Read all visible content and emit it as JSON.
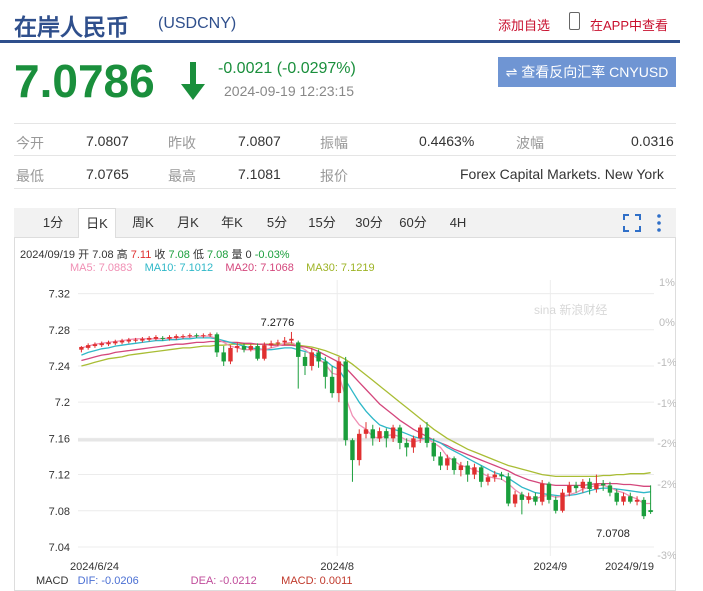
{
  "header": {
    "title": "在岸人民币",
    "code": "(USDCNY)",
    "add_fav": "添加自选",
    "app_view": "在APP中查看"
  },
  "quote": {
    "price": "7.0786",
    "change": "-0.0021 (-0.0297%)",
    "time": "2024-09-19 12:23:15",
    "reverse_btn": "⇌ 查看反向汇率 CNYUSD",
    "rows": [
      [
        {
          "label": "今开",
          "value": "7.0807"
        },
        {
          "label": "昨收",
          "value": "7.0807"
        },
        {
          "label": "振幅",
          "value": "0.4463%"
        },
        {
          "label": "波幅",
          "value": "0.0316"
        }
      ],
      [
        {
          "label": "最低",
          "value": "7.0765"
        },
        {
          "label": "最高",
          "value": "7.1081"
        },
        {
          "label": "报价",
          "value": "Forex Capital Markets. New York"
        }
      ]
    ]
  },
  "tabs": [
    "1分",
    "日K",
    "周K",
    "月K",
    "年K",
    "5分",
    "15分",
    "30分",
    "60分",
    "4H"
  ],
  "active_tab": 1,
  "chart_info": {
    "ohlc": {
      "date": "2024/09/19",
      "open_label": "开",
      "open": "7.08",
      "high_label": "高",
      "high": "7.11",
      "close_label": "收",
      "close": "7.08",
      "low_label": "低",
      "low": "7.08",
      "vol_label": "量",
      "vol": "0",
      "pct": "-0.03%"
    },
    "ma": [
      {
        "label": "MA5: 7.0883",
        "color": "#f08fb4"
      },
      {
        "label": "MA10: 7.1012",
        "color": "#2fb8c8"
      },
      {
        "label": "MA20: 7.1068",
        "color": "#d4477c"
      },
      {
        "label": "MA30: 7.1219",
        "color": "#9db325"
      }
    ],
    "macd_title": "MACD",
    "macd": [
      {
        "label": "DIF: -0.0206",
        "color": "#4a6fd3"
      },
      {
        "label": "DEA: -0.0212",
        "color": "#c04b9a"
      },
      {
        "label": "MACD: 0.0011",
        "color": "#c0392b"
      }
    ]
  },
  "chart_data": {
    "type": "candlestick",
    "y_ticks": [
      "7.32",
      "7.28",
      "7.24",
      "7.2",
      "7.16",
      "7.12",
      "7.08",
      "7.04"
    ],
    "ylim": [
      7.03,
      7.335
    ],
    "pct_ticks": [
      "1%",
      "0%",
      "-1%",
      "-1%",
      "-2%",
      "-2%",
      "-3%"
    ],
    "x_labels": [
      "2024/6/24",
      "2024/8",
      "2024/9",
      "2024/9/19"
    ],
    "annotations": [
      {
        "text": "7.2776"
      },
      {
        "text": "7.0708"
      }
    ],
    "watermark": "sina 新浪财经",
    "up_color": "#e03030",
    "down_color": "#1a9e3c",
    "candles": [
      [
        7.258,
        7.261,
        7.255,
        7.262
      ],
      [
        7.26,
        7.263,
        7.258,
        7.265
      ],
      [
        7.262,
        7.264,
        7.26,
        7.266
      ],
      [
        7.263,
        7.265,
        7.261,
        7.267
      ],
      [
        7.264,
        7.266,
        7.262,
        7.268
      ],
      [
        7.265,
        7.267,
        7.263,
        7.269
      ],
      [
        7.266,
        7.268,
        7.264,
        7.27
      ],
      [
        7.267,
        7.269,
        7.265,
        7.271
      ],
      [
        7.268,
        7.269,
        7.266,
        7.271
      ],
      [
        7.268,
        7.27,
        7.266,
        7.272
      ],
      [
        7.269,
        7.271,
        7.267,
        7.273
      ],
      [
        7.27,
        7.272,
        7.268,
        7.274
      ],
      [
        7.271,
        7.27,
        7.268,
        7.273
      ],
      [
        7.27,
        7.272,
        7.268,
        7.274
      ],
      [
        7.271,
        7.273,
        7.269,
        7.275
      ],
      [
        7.272,
        7.273,
        7.27,
        7.275
      ],
      [
        7.273,
        7.274,
        7.271,
        7.276
      ],
      [
        7.274,
        7.273,
        7.271,
        7.276
      ],
      [
        7.273,
        7.274,
        7.271,
        7.276
      ],
      [
        7.274,
        7.275,
        7.272,
        7.277
      ],
      [
        7.275,
        7.255,
        7.25,
        7.277
      ],
      [
        7.255,
        7.245,
        7.24,
        7.262
      ],
      [
        7.245,
        7.26,
        7.242,
        7.263
      ],
      [
        7.26,
        7.262,
        7.255,
        7.266
      ],
      [
        7.262,
        7.258,
        7.255,
        7.265
      ],
      [
        7.258,
        7.262,
        7.256,
        7.264
      ],
      [
        7.262,
        7.248,
        7.246,
        7.265
      ],
      [
        7.248,
        7.263,
        7.246,
        7.266
      ],
      [
        7.263,
        7.265,
        7.26,
        7.268
      ],
      [
        7.265,
        7.266,
        7.262,
        7.269
      ],
      [
        7.266,
        7.268,
        7.263,
        7.272
      ],
      [
        7.268,
        7.27,
        7.265,
        7.2776
      ],
      [
        7.266,
        7.25,
        7.215,
        7.268
      ],
      [
        7.25,
        7.24,
        7.23,
        7.255
      ],
      [
        7.24,
        7.255,
        7.235,
        7.26
      ],
      [
        7.255,
        7.245,
        7.238,
        7.258
      ],
      [
        7.245,
        7.228,
        7.215,
        7.25
      ],
      [
        7.228,
        7.21,
        7.205,
        7.24
      ],
      [
        7.21,
        7.245,
        7.2,
        7.25
      ],
      [
        7.245,
        7.158,
        7.152,
        7.25
      ],
      [
        7.158,
        7.136,
        7.112,
        7.16
      ],
      [
        7.136,
        7.165,
        7.13,
        7.17
      ],
      [
        7.165,
        7.17,
        7.16,
        7.178
      ],
      [
        7.17,
        7.16,
        7.152,
        7.175
      ],
      [
        7.16,
        7.168,
        7.156,
        7.172
      ],
      [
        7.168,
        7.16,
        7.15,
        7.171
      ],
      [
        7.16,
        7.172,
        7.156,
        7.175
      ],
      [
        7.172,
        7.155,
        7.148,
        7.175
      ],
      [
        7.155,
        7.15,
        7.14,
        7.16
      ],
      [
        7.15,
        7.16,
        7.144,
        7.163
      ],
      [
        7.16,
        7.172,
        7.155,
        7.175
      ],
      [
        7.172,
        7.155,
        7.15,
        7.178
      ],
      [
        7.155,
        7.14,
        7.135,
        7.16
      ],
      [
        7.14,
        7.13,
        7.125,
        7.145
      ],
      [
        7.13,
        7.138,
        7.125,
        7.142
      ],
      [
        7.138,
        7.125,
        7.12,
        7.14
      ],
      [
        7.125,
        7.13,
        7.118,
        7.134
      ],
      [
        7.13,
        7.12,
        7.112,
        7.135
      ],
      [
        7.12,
        7.128,
        7.115,
        7.132
      ],
      [
        7.128,
        7.112,
        7.106,
        7.13
      ],
      [
        7.112,
        7.117,
        7.108,
        7.121
      ],
      [
        7.117,
        7.12,
        7.112,
        7.124
      ],
      [
        7.12,
        7.118,
        7.114,
        7.123
      ],
      [
        7.118,
        7.088,
        7.085,
        7.122
      ],
      [
        7.088,
        7.098,
        7.084,
        7.102
      ],
      [
        7.098,
        7.092,
        7.076,
        7.101
      ],
      [
        7.092,
        7.096,
        7.088,
        7.1
      ],
      [
        7.096,
        7.09,
        7.086,
        7.1
      ],
      [
        7.09,
        7.11,
        7.086,
        7.114
      ],
      [
        7.11,
        7.092,
        7.088,
        7.112
      ],
      [
        7.092,
        7.08,
        7.077,
        7.096
      ],
      [
        7.08,
        7.1,
        7.078,
        7.104
      ],
      [
        7.1,
        7.108,
        7.096,
        7.112
      ],
      [
        7.108,
        7.105,
        7.1,
        7.112
      ],
      [
        7.105,
        7.112,
        7.1,
        7.115
      ],
      [
        7.112,
        7.104,
        7.098,
        7.116
      ],
      [
        7.104,
        7.11,
        7.1,
        7.12
      ],
      [
        7.11,
        7.108,
        7.102,
        7.114
      ],
      [
        7.108,
        7.1,
        7.096,
        7.112
      ],
      [
        7.1,
        7.09,
        7.086,
        7.104
      ],
      [
        7.09,
        7.096,
        7.086,
        7.1
      ],
      [
        7.096,
        7.09,
        7.088,
        7.1
      ],
      [
        7.09,
        7.092,
        7.086,
        7.096
      ],
      [
        7.092,
        7.074,
        7.0708,
        7.095
      ],
      [
        7.0807,
        7.0786,
        7.0765,
        7.1081
      ]
    ],
    "ma5": [
      7.26,
      7.262,
      7.264,
      7.265,
      7.266,
      7.267,
      7.268,
      7.269,
      7.27,
      7.27,
      7.27,
      7.27,
      7.27,
      7.271,
      7.271,
      7.272,
      7.272,
      7.273,
      7.273,
      7.273,
      7.27,
      7.266,
      7.262,
      7.26,
      7.258,
      7.258,
      7.258,
      7.258,
      7.26,
      7.262,
      7.265,
      7.266,
      7.262,
      7.258,
      7.252,
      7.248,
      7.242,
      7.232,
      7.23,
      7.205,
      7.185,
      7.175,
      7.17,
      7.162,
      7.16,
      7.163,
      7.164,
      7.162,
      7.158,
      7.156,
      7.158,
      7.16,
      7.155,
      7.15,
      7.14,
      7.135,
      7.13,
      7.128,
      7.125,
      7.122,
      7.118,
      7.116,
      7.115,
      7.11,
      7.103,
      7.098,
      7.094,
      7.093,
      7.096,
      7.097,
      7.095,
      7.096,
      7.098,
      7.1,
      7.104,
      7.106,
      7.108,
      7.108,
      7.106,
      7.102,
      7.1,
      7.096,
      7.093,
      7.088,
      7.088
    ],
    "ma10": [
      7.252,
      7.255,
      7.257,
      7.259,
      7.26,
      7.262,
      7.263,
      7.264,
      7.265,
      7.266,
      7.267,
      7.268,
      7.268,
      7.269,
      7.269,
      7.27,
      7.27,
      7.271,
      7.271,
      7.271,
      7.27,
      7.268,
      7.266,
      7.264,
      7.262,
      7.26,
      7.259,
      7.258,
      7.258,
      7.259,
      7.26,
      7.26,
      7.258,
      7.256,
      7.254,
      7.25,
      7.246,
      7.24,
      7.236,
      7.224,
      7.212,
      7.2,
      7.19,
      7.182,
      7.175,
      7.172,
      7.17,
      7.168,
      7.165,
      7.162,
      7.16,
      7.16,
      7.158,
      7.155,
      7.15,
      7.146,
      7.142,
      7.138,
      7.134,
      7.13,
      7.126,
      7.122,
      7.12,
      7.116,
      7.111,
      7.106,
      7.103,
      7.1,
      7.099,
      7.098,
      7.097,
      7.096,
      7.097,
      7.098,
      7.1,
      7.102,
      7.104,
      7.105,
      7.105,
      7.104,
      7.103,
      7.102,
      7.101,
      7.1,
      7.101
    ],
    "ma20": [
      7.246,
      7.248,
      7.25,
      7.252,
      7.253,
      7.255,
      7.256,
      7.257,
      7.258,
      7.259,
      7.26,
      7.261,
      7.262,
      7.263,
      7.264,
      7.264,
      7.265,
      7.266,
      7.266,
      7.267,
      7.267,
      7.267,
      7.266,
      7.266,
      7.265,
      7.265,
      7.264,
      7.264,
      7.263,
      7.263,
      7.263,
      7.263,
      7.262,
      7.261,
      7.259,
      7.256,
      7.252,
      7.248,
      7.244,
      7.238,
      7.23,
      7.222,
      7.214,
      7.206,
      7.198,
      7.192,
      7.186,
      7.18,
      7.175,
      7.17,
      7.166,
      7.162,
      7.158,
      7.155,
      7.152,
      7.148,
      7.145,
      7.142,
      7.139,
      7.136,
      7.133,
      7.13,
      7.127,
      7.124,
      7.12,
      7.117,
      7.114,
      7.112,
      7.11,
      7.109,
      7.108,
      7.108,
      7.108,
      7.108,
      7.108,
      7.109,
      7.11,
      7.11,
      7.11,
      7.11,
      7.109,
      7.109,
      7.108,
      7.107,
      7.107
    ],
    "ma30": [
      7.24,
      7.242,
      7.244,
      7.246,
      7.248,
      7.249,
      7.25,
      7.252,
      7.253,
      7.254,
      7.255,
      7.256,
      7.257,
      7.258,
      7.259,
      7.26,
      7.26,
      7.261,
      7.262,
      7.262,
      7.263,
      7.263,
      7.264,
      7.264,
      7.264,
      7.264,
      7.264,
      7.264,
      7.264,
      7.264,
      7.264,
      7.264,
      7.263,
      7.262,
      7.261,
      7.259,
      7.257,
      7.254,
      7.251,
      7.247,
      7.242,
      7.236,
      7.23,
      7.224,
      7.218,
      7.212,
      7.206,
      7.2,
      7.194,
      7.188,
      7.182,
      7.176,
      7.17,
      7.165,
      7.16,
      7.156,
      7.152,
      7.148,
      7.145,
      7.142,
      7.139,
      7.136,
      7.133,
      7.13,
      7.128,
      7.126,
      7.124,
      7.122,
      7.12,
      7.119,
      7.118,
      7.118,
      7.118,
      7.118,
      7.118,
      7.118,
      7.118,
      7.119,
      7.119,
      7.12,
      7.12,
      7.121,
      7.121,
      7.121,
      7.122
    ]
  }
}
